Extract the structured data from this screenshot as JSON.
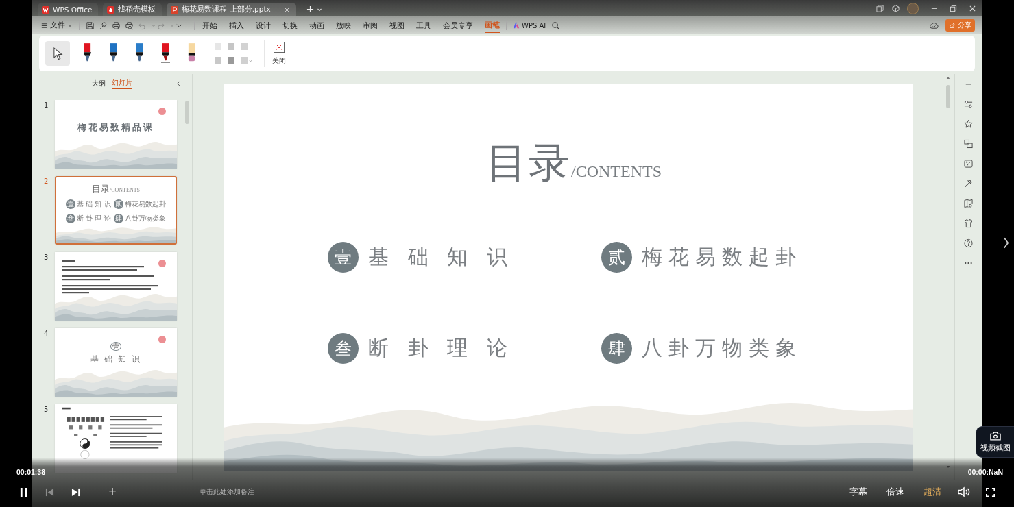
{
  "video_player": {
    "playing": true,
    "current_time": "00:01:38",
    "duration": "00:00:NaN",
    "previous_disabled": true,
    "options": [
      {
        "label": "字幕",
        "selected": false
      },
      {
        "label": "倍速",
        "selected": false
      },
      {
        "label": "超清",
        "selected": true
      }
    ],
    "screenshot_button": "视频截图"
  },
  "window": {
    "tabs": [
      {
        "kind": "home",
        "label": "WPS Office",
        "selected": false
      },
      {
        "kind": "template",
        "label": "找稻壳模板",
        "selected": false
      },
      {
        "kind": "document",
        "label": "梅花易数课程  上部分.pptx",
        "selected": true
      }
    ],
    "file_menu": "文件",
    "ribbon_tabs": [
      {
        "label": "开始",
        "selected": false
      },
      {
        "label": "插入",
        "selected": false
      },
      {
        "label": "设计",
        "selected": false
      },
      {
        "label": "切换",
        "selected": false
      },
      {
        "label": "动画",
        "selected": false
      },
      {
        "label": "放映",
        "selected": false
      },
      {
        "label": "审阅",
        "selected": false
      },
      {
        "label": "视图",
        "selected": false
      },
      {
        "label": "工具",
        "selected": false
      },
      {
        "label": "会员专享",
        "selected": false
      },
      {
        "label": "画笔",
        "selected": true
      }
    ],
    "ai_button": "WPS AI",
    "share_button": "分享"
  },
  "pen_toolbar": {
    "tools": [
      {
        "kind": "select",
        "selected": true
      },
      {
        "kind": "pen",
        "color": "#e01520",
        "selected": false
      },
      {
        "kind": "pen",
        "color": "#1f72c2",
        "selected": false
      },
      {
        "kind": "pen",
        "color": "#2a7dc9",
        "selected": false
      },
      {
        "kind": "marker",
        "color": "#e01520",
        "selected": false
      },
      {
        "kind": "highlighter",
        "color": "#c880a8",
        "selected": false
      }
    ],
    "close_button": "关闭"
  },
  "slide_panel": {
    "tabs": [
      {
        "label": "大纲",
        "selected": false
      },
      {
        "label": "幻灯片",
        "selected": true
      }
    ],
    "slides": [
      {
        "number": "1",
        "kind": "title",
        "selected": false,
        "title": "梅花易数精品课"
      },
      {
        "number": "2",
        "kind": "contents",
        "selected": true,
        "title": "目录",
        "subtitle": "/CONTENTS",
        "items": [
          {
            "badge": "壹",
            "label": "基 础 知 识"
          },
          {
            "badge": "贰",
            "label": "梅花易数起卦"
          },
          {
            "badge": "叁",
            "label": "断 卦 理 论"
          },
          {
            "badge": "肆",
            "label": "八卦万物类象"
          }
        ]
      },
      {
        "number": "3",
        "kind": "text",
        "selected": false
      },
      {
        "number": "4",
        "kind": "section",
        "selected": false,
        "badge": "壹",
        "title": "基 础 知 识"
      },
      {
        "number": "5",
        "kind": "diagram",
        "selected": false
      }
    ],
    "add_button": "+"
  },
  "slide": {
    "title": "目录",
    "subtitle": "/CONTENTS",
    "items": [
      {
        "badge": "壹",
        "label": "基 础 知 识"
      },
      {
        "badge": "贰",
        "label": "梅花易数起卦"
      },
      {
        "badge": "叁",
        "label": "断 卦 理 论"
      },
      {
        "badge": "肆",
        "label": "八卦万物类象"
      }
    ]
  },
  "notes": {
    "placeholder": "单击此处添加备注"
  }
}
